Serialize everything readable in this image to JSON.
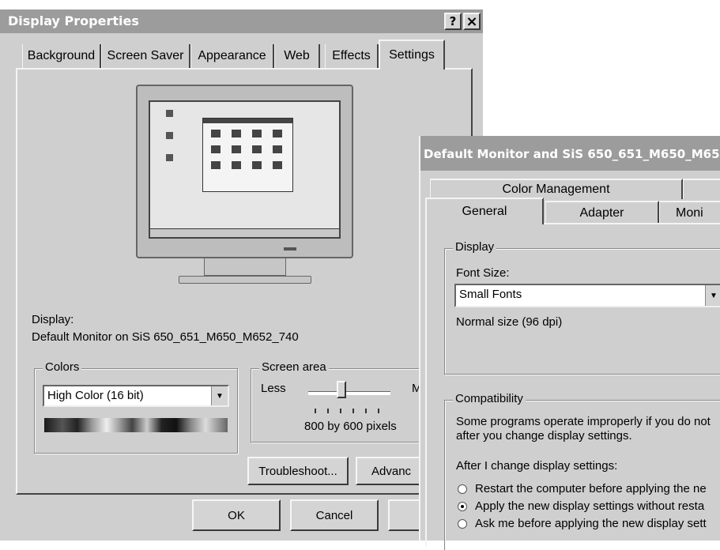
{
  "display_properties": {
    "title": "Display Properties",
    "help_button": "?",
    "close_button": "×",
    "tabs": [
      "Background",
      "Screen Saver",
      "Appearance",
      "Web",
      "Effects",
      "Settings"
    ],
    "display_label": "Display:",
    "display_value": "Default Monitor on SiS 650_651_M650_M652_740",
    "colors": {
      "label": "Colors",
      "selected": "High Color (16 bit)"
    },
    "screen_area": {
      "label": "Screen area",
      "less": "Less",
      "more": "M",
      "value": "800 by 600 pixels"
    },
    "buttons": {
      "troubleshoot": "Troubleshoot...",
      "advanced": "Advanc",
      "ok": "OK",
      "cancel": "Cancel"
    }
  },
  "advanced_dialog": {
    "title": "Default Monitor and SiS 650_651_M650_M65",
    "tabs_back": [
      "Color Management"
    ],
    "tabs_front": [
      "General",
      "Adapter",
      "Moni"
    ],
    "display_group": {
      "label": "Display",
      "font_size_label": "Font Size:",
      "font_size_value": "Small Fonts",
      "font_note": "Normal size (96 dpi)"
    },
    "compatibility_group": {
      "label": "Compatibility",
      "description_line1": "Some programs operate improperly if you do not",
      "description_line2": "after you change display settings.",
      "after_label": "After I change display settings:",
      "options": [
        "Restart the computer before applying the ne",
        "Apply the new display settings without resta",
        "Ask me before applying the new display sett"
      ],
      "selected_index": 1
    }
  },
  "colors": {
    "window_bg": "#cfcfcf",
    "titlebar": "#9c9c9c"
  }
}
